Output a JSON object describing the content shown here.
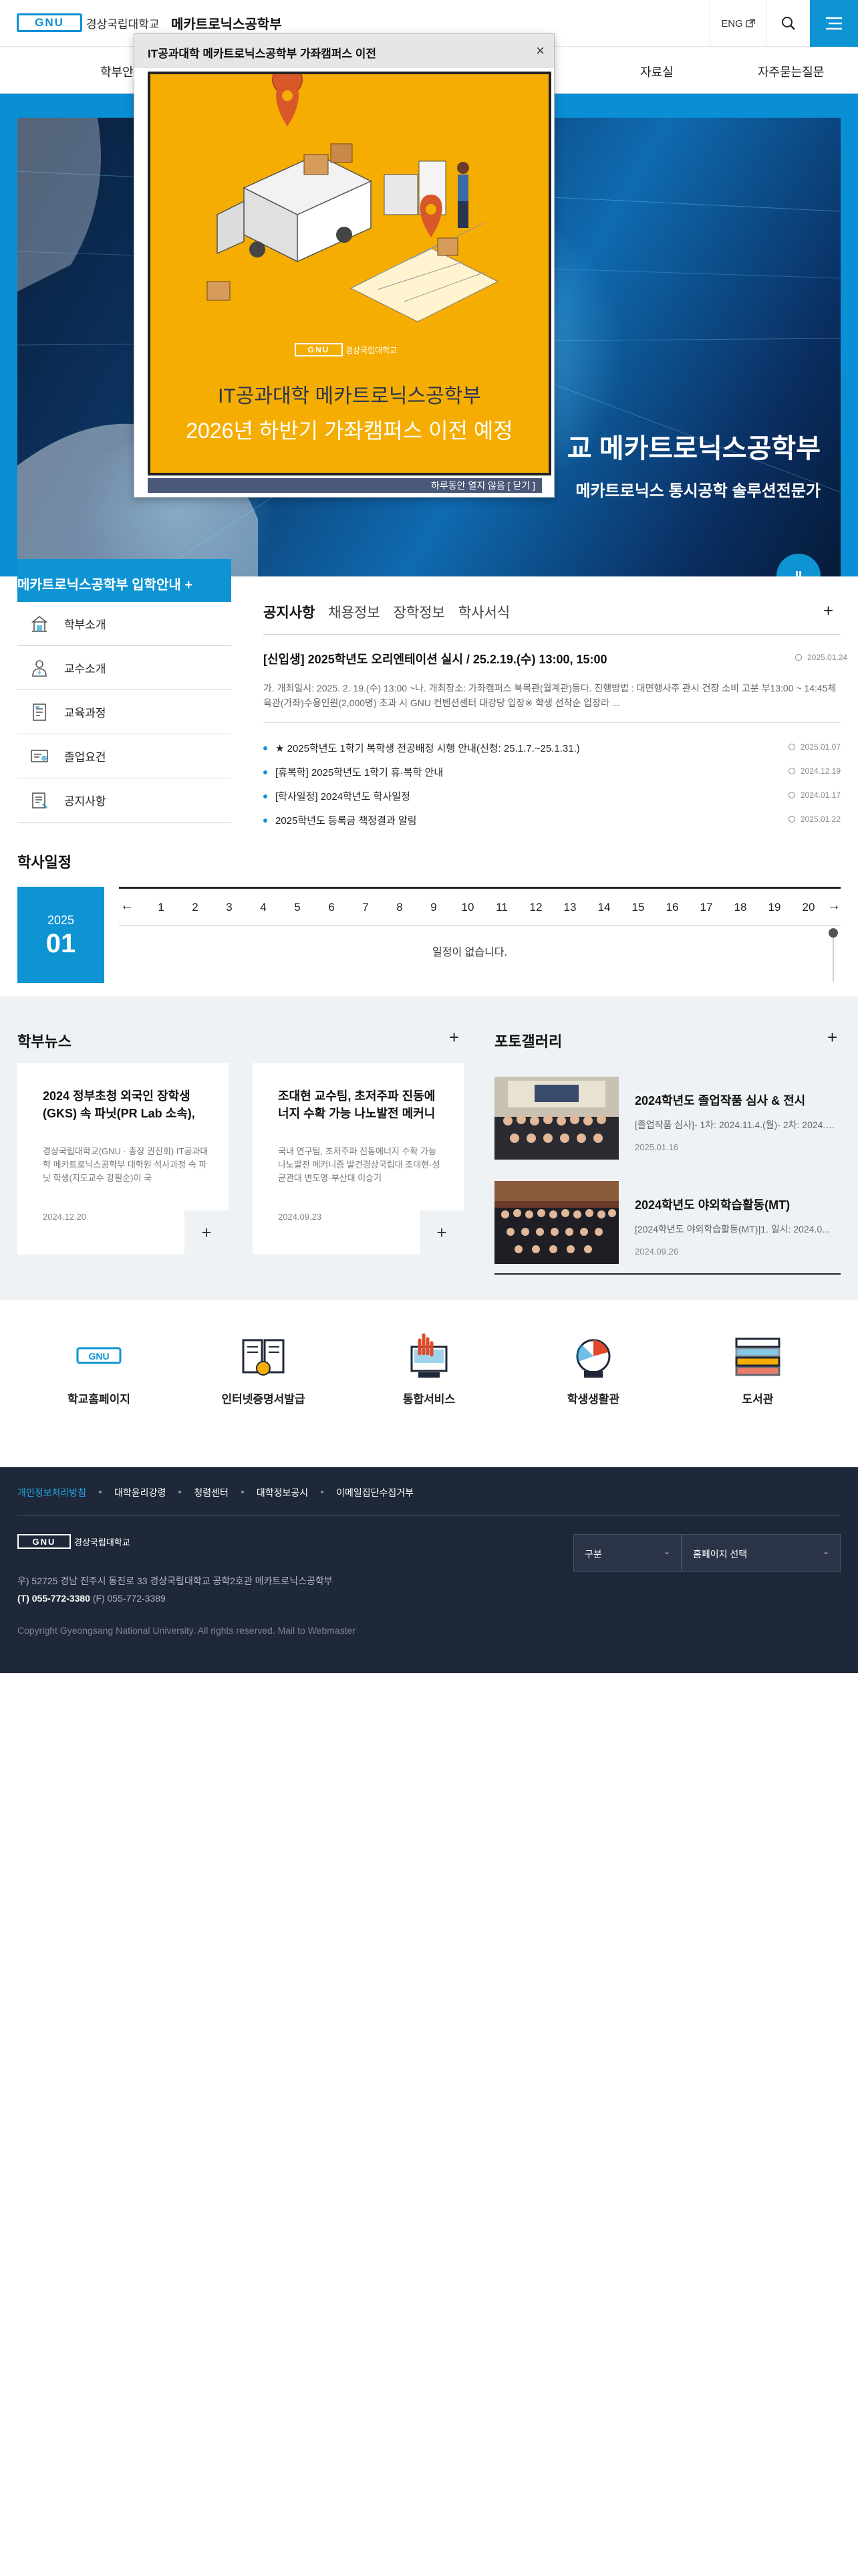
{
  "header": {
    "logo_mark": "GNU",
    "logo_text": "경상국립대학교",
    "dept_name": "메카트로닉스공학부",
    "eng_label": "ENG",
    "brand_color": "#0e94d3"
  },
  "gnb": {
    "items": [
      "학부안",
      "자료실",
      "자주묻는질문"
    ]
  },
  "hero": {
    "title": "교 메카트로닉스공학부",
    "subtitle": "메카트로닉스 통시공학 솔루션전문가",
    "pause_label": "II"
  },
  "popup": {
    "title": "IT공과대학 메카트로닉스공학부 가좌캠퍼스 이전",
    "close_label": "×",
    "logo_mark": "GNU",
    "logo_text": "경상국립대학교",
    "line1": "IT공과대학 메카트로닉스공학부",
    "line2": "2026년 하반기 가좌캠퍼스 이전 예정",
    "footer_text": "하루동안 열지 않음 [ 닫기 ]",
    "bg_color": "#f4ad00"
  },
  "admission": {
    "label": "메카트로닉스공학부 입학안내 +"
  },
  "quick_menu": [
    {
      "label": "학부소개",
      "icon": "building-icon"
    },
    {
      "label": "교수소개",
      "icon": "person-icon"
    },
    {
      "label": "교육과정",
      "icon": "document-icon"
    },
    {
      "label": "졸업요건",
      "icon": "certificate-icon"
    },
    {
      "label": "공지사항",
      "icon": "notice-icon"
    }
  ],
  "notice": {
    "tabs": [
      "공지사항",
      "채용정보",
      "장학정보",
      "학사서식"
    ],
    "plus_label": "+",
    "featured": {
      "title": "[신입생] 2025학년도 오리엔테이션 실시 / 25.2.19.(수) 13:00, 15:00",
      "date": "2025.01.24",
      "body": "가. 개최일시: 2025. 2. 19.(수) 13:00 ~나. 개최장소: 가좌캠퍼스 북목관(월계관)등다. 진행방법 : 대면행사주 관시 건장 소비 고분 부13:00 ~ 14:45체육관(가좌)수용인원(2,000명) 초과 시 GNU 컨벤션센터 대강당 입장※ 학생 선착순 입장라 ..."
    },
    "items": [
      {
        "title": "★ 2025학년도 1학기 복학생 전공배정 시행 안내(신청: 25.1.7.~25.1.31.)",
        "date": "2025.01.07"
      },
      {
        "title": "[휴복학] 2025학년도 1학기 휴·복학 안내",
        "date": "2024.12.19"
      },
      {
        "title": "[학사일정] 2024학년도 학사일정",
        "date": "2024.01.17"
      },
      {
        "title": "2025학년도 등록금 책정결과 알림",
        "date": "2025.01.22"
      }
    ]
  },
  "calendar": {
    "title": "학사일정",
    "year": "2025",
    "month": "01",
    "days": [
      "1",
      "2",
      "3",
      "4",
      "5",
      "6",
      "7",
      "8",
      "9",
      "10",
      "11",
      "12",
      "13",
      "14",
      "15",
      "16",
      "17",
      "18",
      "19",
      "20"
    ],
    "prev_label": "←",
    "next_label": "→",
    "empty_text": "일정이 없습니다."
  },
  "news": {
    "title": "학부뉴스",
    "plus_label": "+",
    "items": [
      {
        "title": "2024 정부초청 외국인 장학생(GKS) 속 파닛(PR Lab 소속),",
        "body": "경상국립대학교(GNU · 총장 권진회) IT공과대학 메카트로닉스공학부 대학원 석사과정 속 파닛 학생(지도교수 강필순)이 국",
        "date": "2024.12.20",
        "plus": "+"
      },
      {
        "title": "조대현 교수팀, 초저주파 진동에너지 수확 가능 나노발전 메커니",
        "body": "국내 연구팀, 초저주파 진동에너지 수확 가능 나노발전 메커니즘 발견경상국립대 조대현·성균관대 변도영·부산대 이승기",
        "date": "2024.09.23",
        "plus": "+"
      }
    ]
  },
  "gallery": {
    "title": "포토갤러리",
    "plus_label": "+",
    "items": [
      {
        "title": "2024학년도 졸업작품 심사 & 전시",
        "desc": "[졸업작품 심사]- 1차: 2024.11.4.(월)- 2차: 2024.11.",
        "date": "2025.01.16"
      },
      {
        "title": "2024학년도 야외학습활동(MT)",
        "desc": "[2024학년도 야외학습활동(MT)]1. 일시: 2024.0...",
        "date": "2024.09.26"
      }
    ]
  },
  "services": [
    {
      "label": "학교홈페이지",
      "icon": "gnu-logo-icon"
    },
    {
      "label": "인터넷증명서발급",
      "icon": "certificate-book-icon"
    },
    {
      "label": "통합서비스",
      "icon": "service-hand-icon"
    },
    {
      "label": "학생생활관",
      "icon": "dormitory-icon"
    },
    {
      "label": "도서관",
      "icon": "books-icon"
    }
  ],
  "footer": {
    "links": [
      "개인정보처리방침",
      "대학윤리강령",
      "청렴센터",
      "대학정보공시",
      "이메일집단수집거부"
    ],
    "logo_mark": "GNU",
    "logo_text": "경상국립대학교",
    "address": "우) 52725 경남 진주시 동진로 33 경상국립대학교 공학2호관 메카트로닉스공학부",
    "tel_label": "(T) 055-772-3380",
    "fax_label": "(F) 055-772-3389",
    "copyright": "Copyright Gyeongsang National University. All rights reserved. Mail to Webmaster",
    "select1": "구분",
    "select2": "홈페이지 선택"
  }
}
